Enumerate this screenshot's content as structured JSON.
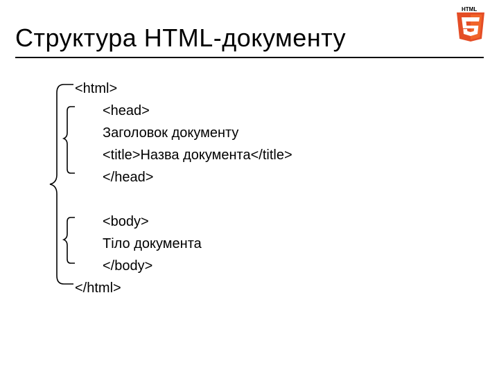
{
  "title": "Структура HTML-документу",
  "code": {
    "l0": "<html>",
    "l1": "<head>",
    "l2": "Заголовок документу",
    "l3": "<title>Назва документа</title>",
    "l4": "</head>",
    "l5": "<body>",
    "l6": "Тіло документа",
    "l7": "</body>",
    "l8": "</html>"
  }
}
